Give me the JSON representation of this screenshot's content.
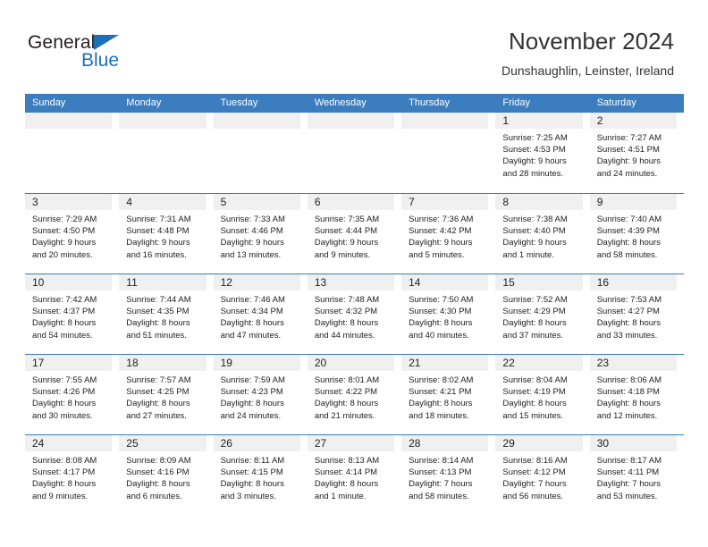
{
  "brand": {
    "name_part1": "General",
    "name_part2": "Blue",
    "accent_color": "#1c70b8"
  },
  "header": {
    "title": "November 2024",
    "subtitle": "Dunshaughlin, Leinster, Ireland",
    "header_bg_color": "#3b7dbf"
  },
  "weekdays": [
    "Sunday",
    "Monday",
    "Tuesday",
    "Wednesday",
    "Thursday",
    "Friday",
    "Saturday"
  ],
  "weeks": [
    [
      {
        "day": "",
        "sunrise": "",
        "sunset": "",
        "daylight_line1": "",
        "daylight_line2": ""
      },
      {
        "day": "",
        "sunrise": "",
        "sunset": "",
        "daylight_line1": "",
        "daylight_line2": ""
      },
      {
        "day": "",
        "sunrise": "",
        "sunset": "",
        "daylight_line1": "",
        "daylight_line2": ""
      },
      {
        "day": "",
        "sunrise": "",
        "sunset": "",
        "daylight_line1": "",
        "daylight_line2": ""
      },
      {
        "day": "",
        "sunrise": "",
        "sunset": "",
        "daylight_line1": "",
        "daylight_line2": ""
      },
      {
        "day": "1",
        "sunrise": "Sunrise: 7:25 AM",
        "sunset": "Sunset: 4:53 PM",
        "daylight_line1": "Daylight: 9 hours",
        "daylight_line2": "and 28 minutes."
      },
      {
        "day": "2",
        "sunrise": "Sunrise: 7:27 AM",
        "sunset": "Sunset: 4:51 PM",
        "daylight_line1": "Daylight: 9 hours",
        "daylight_line2": "and 24 minutes."
      }
    ],
    [
      {
        "day": "3",
        "sunrise": "Sunrise: 7:29 AM",
        "sunset": "Sunset: 4:50 PM",
        "daylight_line1": "Daylight: 9 hours",
        "daylight_line2": "and 20 minutes."
      },
      {
        "day": "4",
        "sunrise": "Sunrise: 7:31 AM",
        "sunset": "Sunset: 4:48 PM",
        "daylight_line1": "Daylight: 9 hours",
        "daylight_line2": "and 16 minutes."
      },
      {
        "day": "5",
        "sunrise": "Sunrise: 7:33 AM",
        "sunset": "Sunset: 4:46 PM",
        "daylight_line1": "Daylight: 9 hours",
        "daylight_line2": "and 13 minutes."
      },
      {
        "day": "6",
        "sunrise": "Sunrise: 7:35 AM",
        "sunset": "Sunset: 4:44 PM",
        "daylight_line1": "Daylight: 9 hours",
        "daylight_line2": "and 9 minutes."
      },
      {
        "day": "7",
        "sunrise": "Sunrise: 7:36 AM",
        "sunset": "Sunset: 4:42 PM",
        "daylight_line1": "Daylight: 9 hours",
        "daylight_line2": "and 5 minutes."
      },
      {
        "day": "8",
        "sunrise": "Sunrise: 7:38 AM",
        "sunset": "Sunset: 4:40 PM",
        "daylight_line1": "Daylight: 9 hours",
        "daylight_line2": "and 1 minute."
      },
      {
        "day": "9",
        "sunrise": "Sunrise: 7:40 AM",
        "sunset": "Sunset: 4:39 PM",
        "daylight_line1": "Daylight: 8 hours",
        "daylight_line2": "and 58 minutes."
      }
    ],
    [
      {
        "day": "10",
        "sunrise": "Sunrise: 7:42 AM",
        "sunset": "Sunset: 4:37 PM",
        "daylight_line1": "Daylight: 8 hours",
        "daylight_line2": "and 54 minutes."
      },
      {
        "day": "11",
        "sunrise": "Sunrise: 7:44 AM",
        "sunset": "Sunset: 4:35 PM",
        "daylight_line1": "Daylight: 8 hours",
        "daylight_line2": "and 51 minutes."
      },
      {
        "day": "12",
        "sunrise": "Sunrise: 7:46 AM",
        "sunset": "Sunset: 4:34 PM",
        "daylight_line1": "Daylight: 8 hours",
        "daylight_line2": "and 47 minutes."
      },
      {
        "day": "13",
        "sunrise": "Sunrise: 7:48 AM",
        "sunset": "Sunset: 4:32 PM",
        "daylight_line1": "Daylight: 8 hours",
        "daylight_line2": "and 44 minutes."
      },
      {
        "day": "14",
        "sunrise": "Sunrise: 7:50 AM",
        "sunset": "Sunset: 4:30 PM",
        "daylight_line1": "Daylight: 8 hours",
        "daylight_line2": "and 40 minutes."
      },
      {
        "day": "15",
        "sunrise": "Sunrise: 7:52 AM",
        "sunset": "Sunset: 4:29 PM",
        "daylight_line1": "Daylight: 8 hours",
        "daylight_line2": "and 37 minutes."
      },
      {
        "day": "16",
        "sunrise": "Sunrise: 7:53 AM",
        "sunset": "Sunset: 4:27 PM",
        "daylight_line1": "Daylight: 8 hours",
        "daylight_line2": "and 33 minutes."
      }
    ],
    [
      {
        "day": "17",
        "sunrise": "Sunrise: 7:55 AM",
        "sunset": "Sunset: 4:26 PM",
        "daylight_line1": "Daylight: 8 hours",
        "daylight_line2": "and 30 minutes."
      },
      {
        "day": "18",
        "sunrise": "Sunrise: 7:57 AM",
        "sunset": "Sunset: 4:25 PM",
        "daylight_line1": "Daylight: 8 hours",
        "daylight_line2": "and 27 minutes."
      },
      {
        "day": "19",
        "sunrise": "Sunrise: 7:59 AM",
        "sunset": "Sunset: 4:23 PM",
        "daylight_line1": "Daylight: 8 hours",
        "daylight_line2": "and 24 minutes."
      },
      {
        "day": "20",
        "sunrise": "Sunrise: 8:01 AM",
        "sunset": "Sunset: 4:22 PM",
        "daylight_line1": "Daylight: 8 hours",
        "daylight_line2": "and 21 minutes."
      },
      {
        "day": "21",
        "sunrise": "Sunrise: 8:02 AM",
        "sunset": "Sunset: 4:21 PM",
        "daylight_line1": "Daylight: 8 hours",
        "daylight_line2": "and 18 minutes."
      },
      {
        "day": "22",
        "sunrise": "Sunrise: 8:04 AM",
        "sunset": "Sunset: 4:19 PM",
        "daylight_line1": "Daylight: 8 hours",
        "daylight_line2": "and 15 minutes."
      },
      {
        "day": "23",
        "sunrise": "Sunrise: 8:06 AM",
        "sunset": "Sunset: 4:18 PM",
        "daylight_line1": "Daylight: 8 hours",
        "daylight_line2": "and 12 minutes."
      }
    ],
    [
      {
        "day": "24",
        "sunrise": "Sunrise: 8:08 AM",
        "sunset": "Sunset: 4:17 PM",
        "daylight_line1": "Daylight: 8 hours",
        "daylight_line2": "and 9 minutes."
      },
      {
        "day": "25",
        "sunrise": "Sunrise: 8:09 AM",
        "sunset": "Sunset: 4:16 PM",
        "daylight_line1": "Daylight: 8 hours",
        "daylight_line2": "and 6 minutes."
      },
      {
        "day": "26",
        "sunrise": "Sunrise: 8:11 AM",
        "sunset": "Sunset: 4:15 PM",
        "daylight_line1": "Daylight: 8 hours",
        "daylight_line2": "and 3 minutes."
      },
      {
        "day": "27",
        "sunrise": "Sunrise: 8:13 AM",
        "sunset": "Sunset: 4:14 PM",
        "daylight_line1": "Daylight: 8 hours",
        "daylight_line2": "and 1 minute."
      },
      {
        "day": "28",
        "sunrise": "Sunrise: 8:14 AM",
        "sunset": "Sunset: 4:13 PM",
        "daylight_line1": "Daylight: 7 hours",
        "daylight_line2": "and 58 minutes."
      },
      {
        "day": "29",
        "sunrise": "Sunrise: 8:16 AM",
        "sunset": "Sunset: 4:12 PM",
        "daylight_line1": "Daylight: 7 hours",
        "daylight_line2": "and 56 minutes."
      },
      {
        "day": "30",
        "sunrise": "Sunrise: 8:17 AM",
        "sunset": "Sunset: 4:11 PM",
        "daylight_line1": "Daylight: 7 hours",
        "daylight_line2": "and 53 minutes."
      }
    ]
  ]
}
